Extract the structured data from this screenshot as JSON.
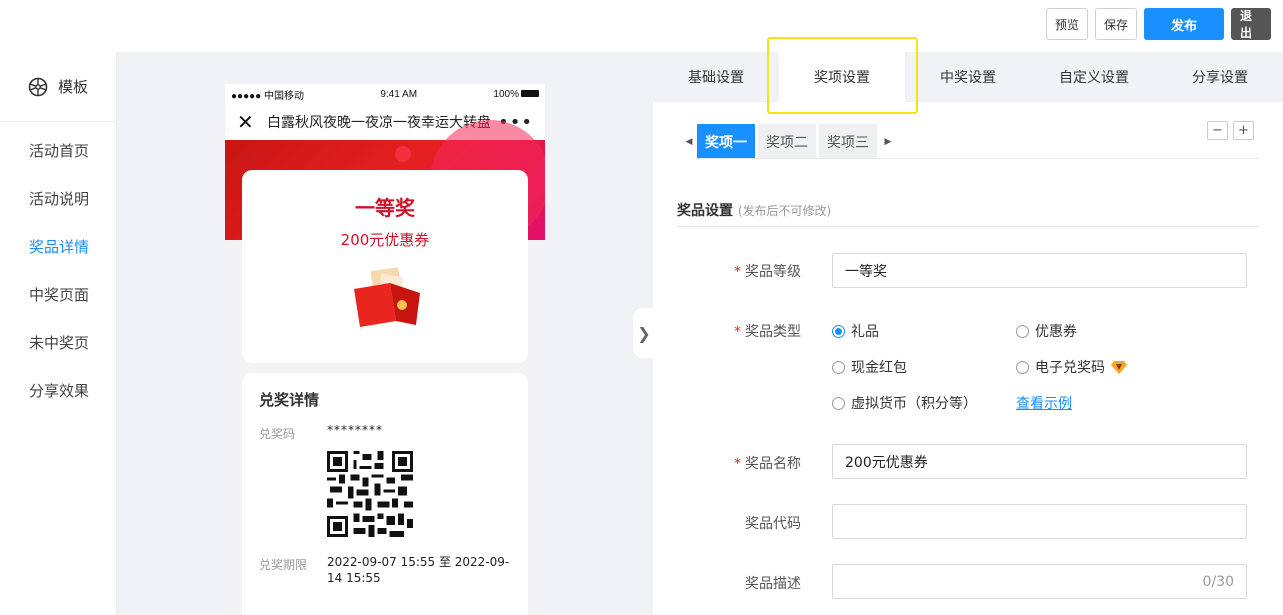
{
  "toolbar": {
    "preview": "预览",
    "save": "保存",
    "publish": "发布",
    "exit": "退出"
  },
  "sidebar": {
    "header": "模板",
    "items": [
      {
        "label": "活动首页"
      },
      {
        "label": "活动说明"
      },
      {
        "label": "奖品详情",
        "active": true
      },
      {
        "label": "中奖页面"
      },
      {
        "label": "未中奖页"
      },
      {
        "label": "分享效果"
      }
    ]
  },
  "phone": {
    "status": {
      "carrier": "●●●●● 中国移动",
      "time": "9:41 AM",
      "battery": "100%"
    },
    "title": "白露秋风夜晚一夜凉一夜幸运大转盘",
    "prize_level": "一等奖",
    "prize_name": "200元优惠券",
    "detail": {
      "heading": "兑奖详情",
      "code_label": "兑奖码",
      "code_value": "********",
      "period_label": "兑奖期限",
      "period_value": "2022-09-07 15:55 至 2022-09-14 15:55"
    }
  },
  "panel": {
    "tabs": [
      "基础设置",
      "奖项设置",
      "中奖设置",
      "自定义设置",
      "分享设置"
    ],
    "prize_tabs": [
      "奖项一",
      "奖项二",
      "奖项三"
    ],
    "section_title": "奖品设置",
    "section_note": "(发布后不可修改)",
    "fields": {
      "level_label": "奖品等级",
      "level_value": "一等奖",
      "type_label": "奖品类型",
      "types": [
        "礼品",
        "优惠券",
        "现金红包",
        "电子兑奖码",
        "虚拟货币（积分等）"
      ],
      "example_link": "查看示例",
      "name_label": "奖品名称",
      "name_value": "200元优惠券",
      "code_label": "奖品代码",
      "code_value": "",
      "desc_label": "奖品描述",
      "desc_counter": "0/30"
    }
  },
  "colors": {
    "accent": "#1890ff",
    "highlight": "#f5e31a",
    "prize_red": "#d0112b"
  }
}
